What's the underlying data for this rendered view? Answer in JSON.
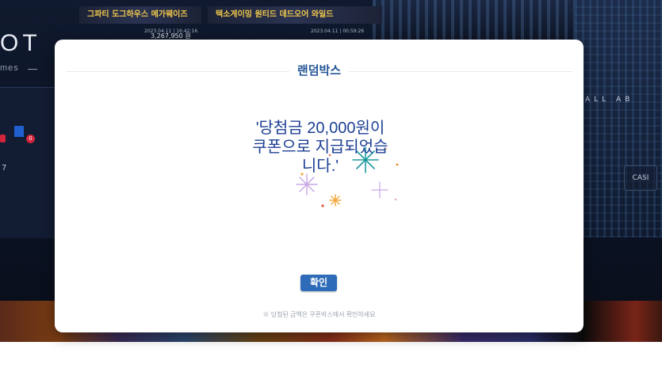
{
  "background": {
    "logo_text": "OT",
    "logo_sub": "mes",
    "strip_1": "그파티 도그하우스 메가웨이즈",
    "strip_2": "텍소게이밍 원티드 데드오어 와일드",
    "strip_1_date": "2023.04.11 | 16:42:16",
    "strip_2_date": "2023.04.11 | 00:59:26",
    "strip_1_amount": "3,267,950 원",
    "badge_count": "0",
    "side_number": "7",
    "right_text": "ALL AB",
    "casino_label": "CASI"
  },
  "modal": {
    "title": "랜덤박스",
    "message_line1": "'당첨금 20,000원이",
    "message_line2": "쿠폰으로 지급되었습",
    "message_line3": "니다.'",
    "confirm_label": "확인",
    "footnote": "※ 당첨된 금액은 쿠폰박스에서 확인하세요"
  },
  "colors": {
    "accent": "#2e6bb8",
    "title": "#245597",
    "message": "#1c3f94",
    "modal_bg": "#ffffff"
  }
}
